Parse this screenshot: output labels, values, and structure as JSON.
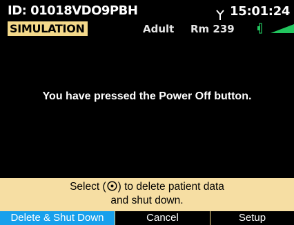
{
  "header": {
    "device_id": "ID: 01018VDO9PBH",
    "mode_badge": "SIMULATION",
    "patient_type": "Adult",
    "room": "Rm 239",
    "time": "15:01:24",
    "signal_icon": "antenna-icon",
    "battery_icon": "battery-icon",
    "battery_level": 0.78
  },
  "message": "You have pressed the Power Off button.",
  "prompt": {
    "line1_before": "Select (",
    "line1_after": ") to delete patient data",
    "line2": "and shut down.",
    "select_icon": "select-knob-icon"
  },
  "softkeys": [
    {
      "label": "Delete & Shut Down"
    },
    {
      "label": "Cancel"
    },
    {
      "label": "Setup"
    }
  ],
  "colors": {
    "background": "#000000",
    "badge": "#f4d98a",
    "prompt_bg": "#f6dea3",
    "softkey_active": "#18a0ec",
    "battery_green": "#22c55e"
  }
}
